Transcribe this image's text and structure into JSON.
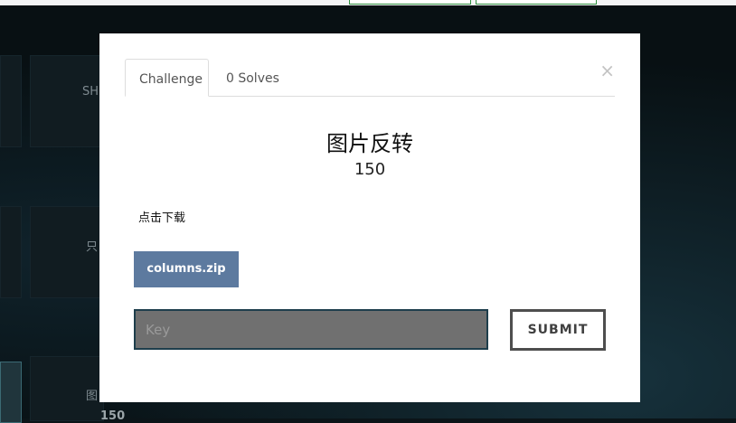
{
  "background": {
    "items": [
      "SH",
      "只",
      "图",
      "150"
    ]
  },
  "modal": {
    "tabs": [
      {
        "label": "Challenge",
        "active": true
      },
      {
        "label": "0 Solves",
        "active": false
      }
    ],
    "close_glyph": "×",
    "challenge": {
      "name": "图片反转",
      "value": "150",
      "description": "点击下载",
      "file_label": "columns.zip"
    },
    "key_input": {
      "placeholder": "Key",
      "value": ""
    },
    "submit_label": "SUBMIT"
  },
  "colors": {
    "file_button": "#5d7a9f",
    "input_background": "#707070",
    "input_border": "#1e3e4c",
    "submit_border": "#4e4e4e"
  }
}
